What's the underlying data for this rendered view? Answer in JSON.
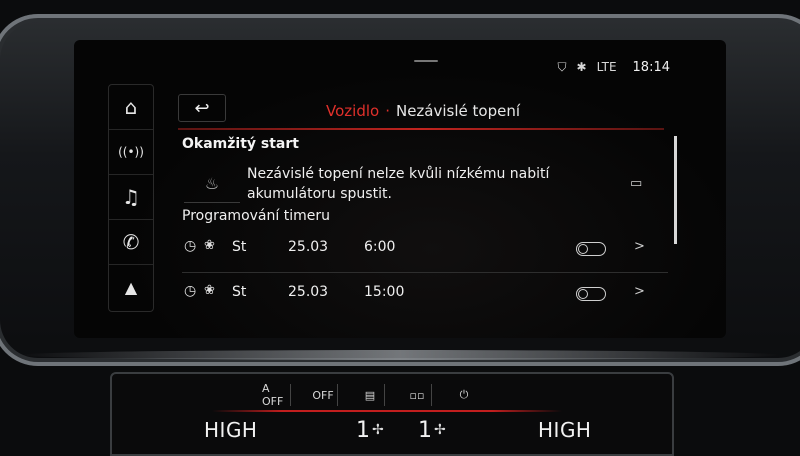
{
  "status": {
    "time": "18:14",
    "network": "LTE"
  },
  "nav": {
    "items": [
      {
        "name": "home-icon",
        "glyph": "⌂"
      },
      {
        "name": "radio-icon",
        "glyph": "((•))"
      },
      {
        "name": "music-icon",
        "glyph": "♫"
      },
      {
        "name": "phone-icon",
        "glyph": "✆"
      },
      {
        "name": "navigation-icon",
        "glyph": "▲"
      }
    ]
  },
  "header": {
    "back_glyph": "↩",
    "crumb_parent": "Vozidlo",
    "crumb_separator": "·",
    "crumb_current": "Nezávislé topení"
  },
  "instant_start": {
    "title": "Okamžitý start",
    "message": "Nezávislé topení nelze kvůli nízkému nabití akumulátoru spustit."
  },
  "timer": {
    "title": "Programování timeru",
    "rows": [
      {
        "day": "St",
        "date": "25.03",
        "time": "6:00",
        "enabled": false
      },
      {
        "day": "St",
        "date": "25.03",
        "time": "15:00",
        "enabled": false
      }
    ]
  },
  "climate": {
    "left_level": "HIGH",
    "right_level": "HIGH",
    "left_fan": "1",
    "right_fan": "1",
    "buttons": [
      "A OFF",
      "OFF",
      "",
      "",
      ""
    ]
  },
  "colors": {
    "accent": "#e0302b",
    "text": "#f0f0f0",
    "background": "#050505"
  }
}
